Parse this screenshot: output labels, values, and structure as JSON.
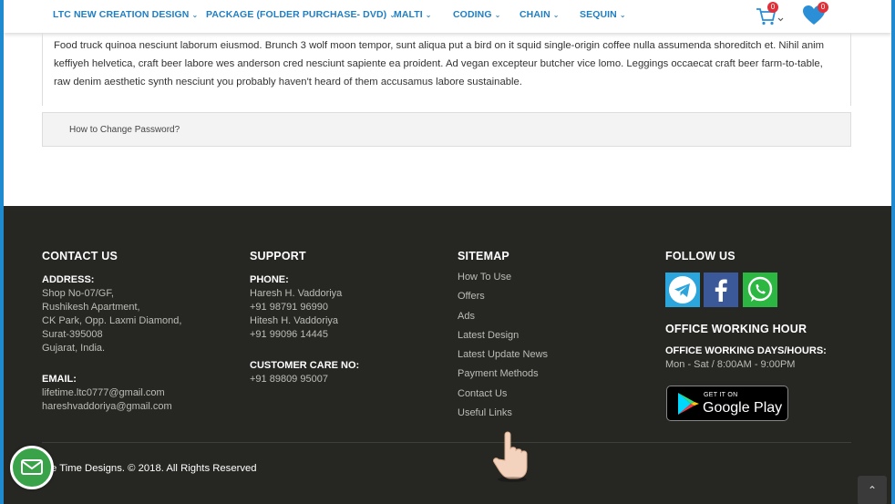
{
  "nav": {
    "items": [
      {
        "label": "LTC NEW CREATION DESIGN"
      },
      {
        "label": "PACKAGE (FOLDER PURCHASE- DVD)"
      },
      {
        "label": "MALTI"
      },
      {
        "label": "CODING"
      },
      {
        "label": "CHAIN"
      },
      {
        "label": "SEQUIN"
      }
    ],
    "cart_count": "0",
    "wishlist_count": "0"
  },
  "faq": {
    "answer": "Food truck quinoa nesciunt laborum eiusmod. Brunch 3 wolf moon tempor, sunt aliqua put a bird on it squid single-origin coffee nulla assumenda shoreditch et. Nihil anim keffiyeh helvetica, craft beer labore wes anderson cred nesciunt sapiente ea proident. Ad vegan excepteur butcher vice lomo. Leggings occaecat craft beer farm-to-table, raw denim aesthetic synth nesciunt you probably haven't heard of them accusamus labore sustainable.",
    "question": "How to Change Password?"
  },
  "footer": {
    "contact": {
      "title": "CONTACT US",
      "address_label": "ADDRESS:",
      "address_lines": [
        "Shop No-07/GF,",
        "Rushikesh Apartment,",
        "CK Park, Opp. Laxmi Diamond,",
        "Surat-395008",
        "Gujarat, India."
      ],
      "email_label": "EMAIL:",
      "emails": [
        "lifetime.ltc0777@gmail.com",
        "hareshvaddoriya@gmail.com"
      ]
    },
    "support": {
      "title": "SUPPORT",
      "phone_label": "PHONE:",
      "phone_lines": [
        "Haresh H. Vaddoriya",
        "+91 98791 96990",
        "Hitesh H. Vaddoriya",
        "+91 99096 14445"
      ],
      "care_label": "CUSTOMER CARE NO:",
      "care_number": "+91 89809 95007"
    },
    "sitemap": {
      "title": "SITEMAP",
      "links": [
        "How To Use",
        "Offers",
        "Ads",
        "Latest Design",
        "Latest Update News",
        "Payment Methods",
        "Contact Us",
        "Useful Links"
      ]
    },
    "follow": {
      "title": "FOLLOW US",
      "office_title": "OFFICE WORKING HOUR",
      "days_label": "OFFICE WORKING DAYS/HOURS:",
      "hours": "Mon - Sat / 8:00AM - 9:00PM",
      "gplay_small": "GET IT ON",
      "gplay_big": "Google Play",
      "colors": {
        "telegram": "#2ca4dc",
        "facebook": "#3b5998",
        "whatsapp": "#2bb741"
      }
    },
    "copyright": "e Time Designs. © 2018. All Rights Reserved"
  }
}
